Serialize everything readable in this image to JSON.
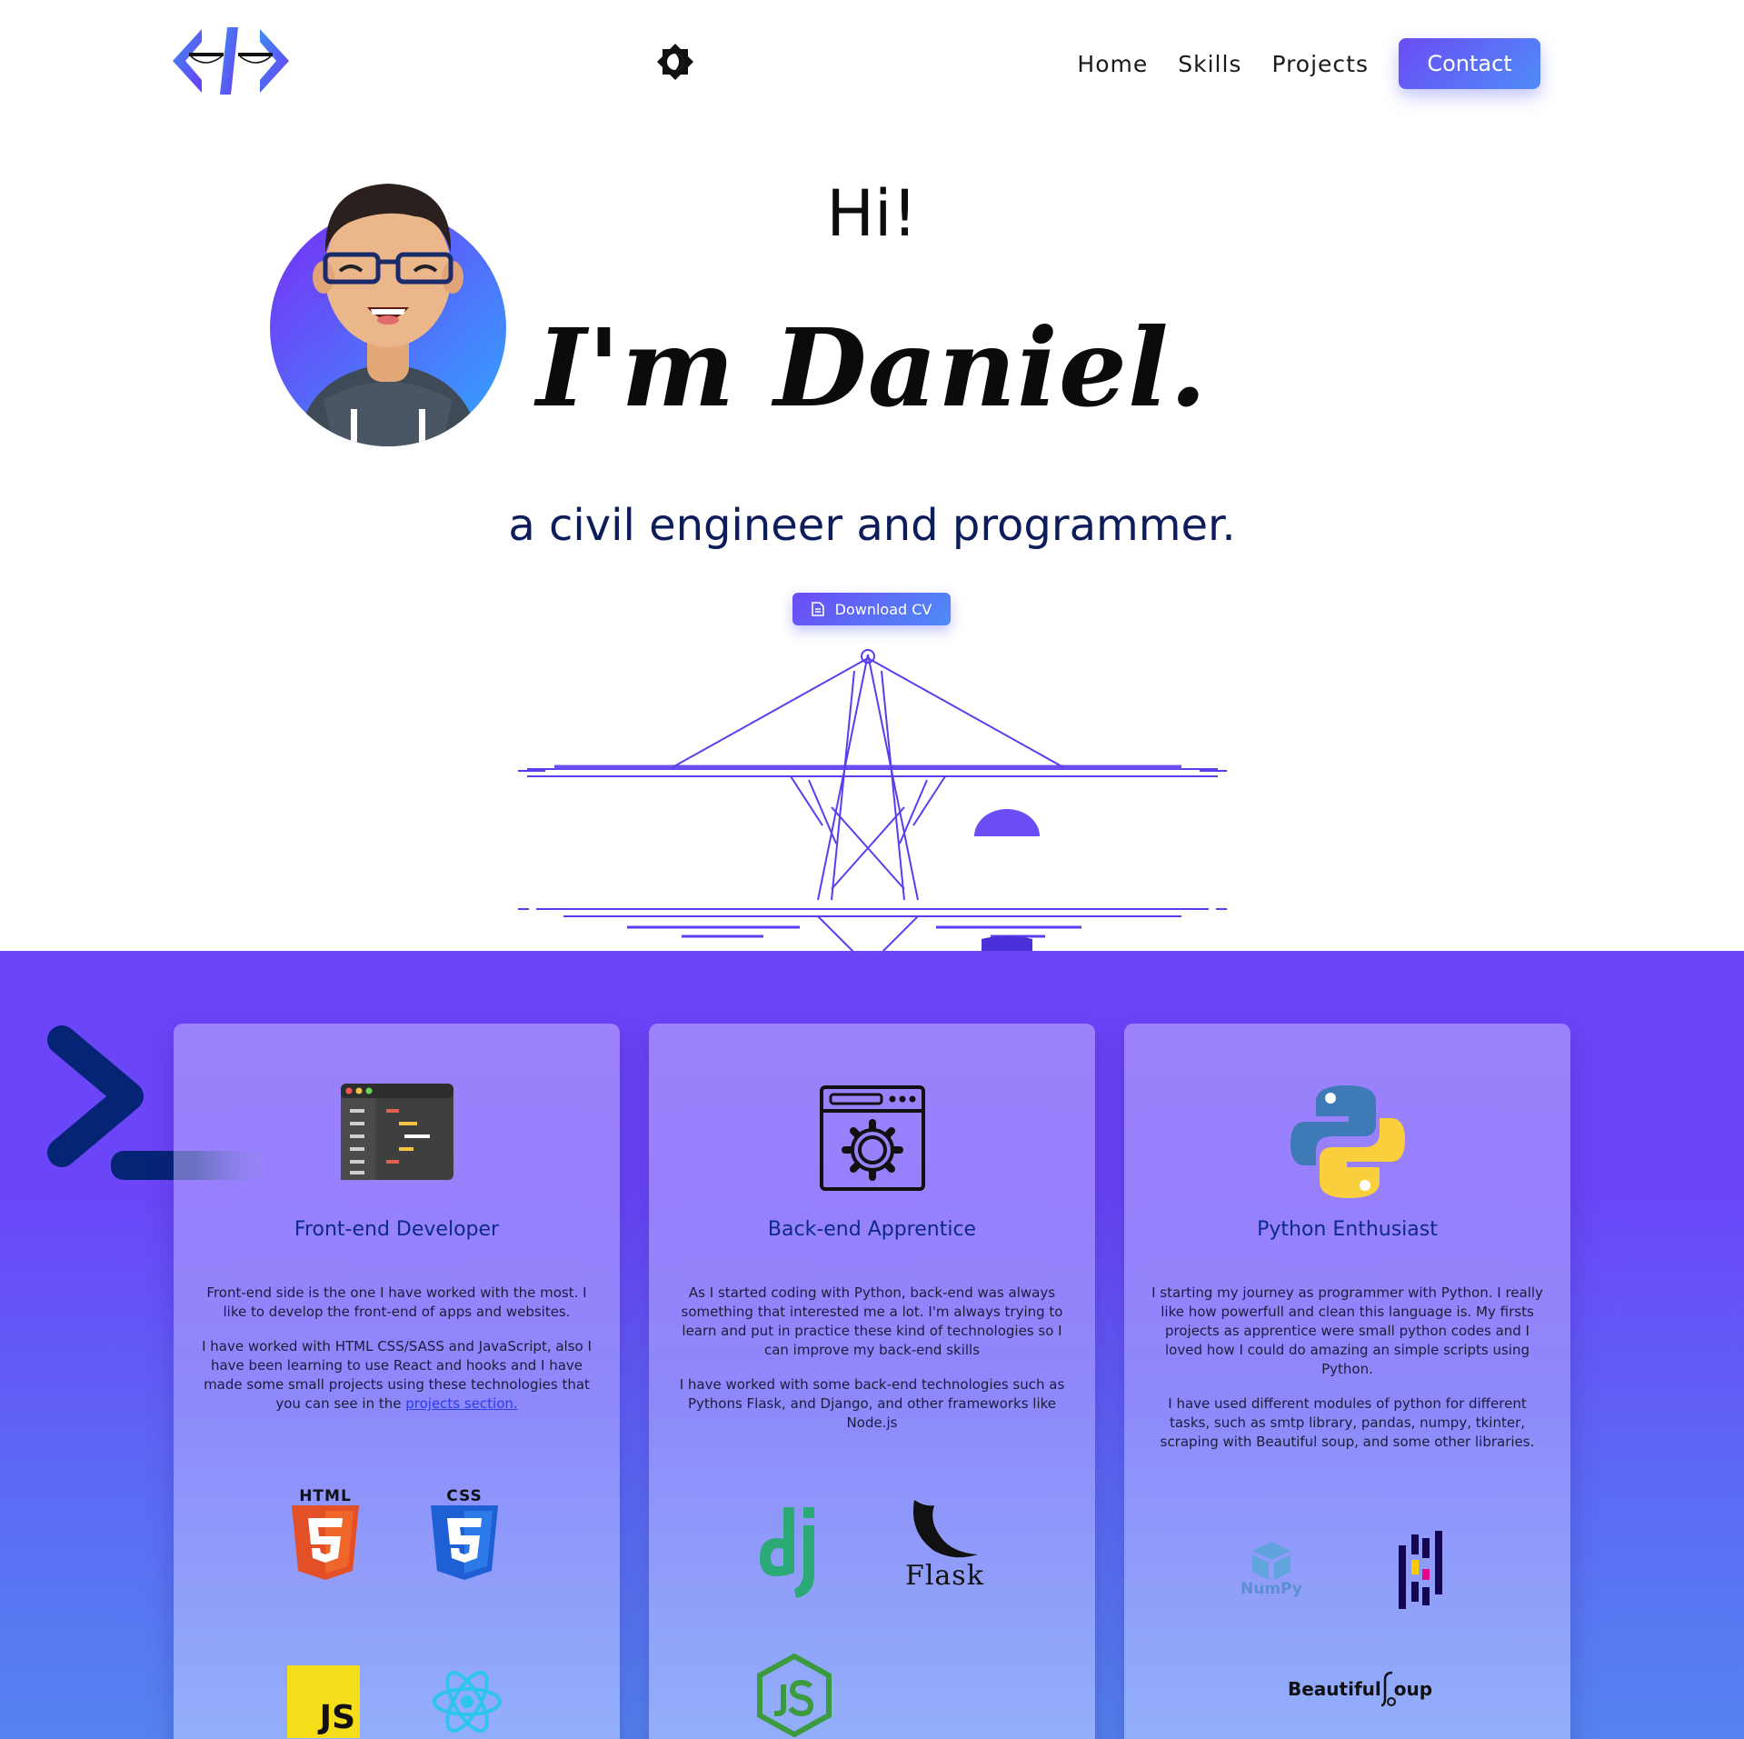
{
  "nav": {
    "home": "Home",
    "skills": "Skills",
    "projects": "Projects",
    "contact": "Contact"
  },
  "hero": {
    "greeting": "Hi!",
    "name": "I'm Daniel.",
    "role": "a civil engineer and programmer.",
    "cv_button": "Download CV"
  },
  "cards": [
    {
      "title": "Front-end Developer",
      "p1": "Front-end side is the one I have worked with the most. I like to develop the front-end of apps and websites.",
      "p2": "I have worked with HTML CSS/SASS and JavaScript, also I have been learning to use React and hooks and I have made some small projects using these technologies that you can see in the ",
      "link": "projects section.",
      "techs": [
        "HTML",
        "CSS",
        "JS",
        "React"
      ]
    },
    {
      "title": "Back-end Apprentice",
      "p1": "As I started coding with Python, back-end was always something that interested me a lot. I'm always trying to learn and put in practice these kind of technologies so I can improve my back-end skills",
      "p2": "I have worked with some back-end technologies such as Pythons Flask, and Django, and other frameworks like Node.js",
      "techs": [
        "dj",
        "Flask",
        "Node.js"
      ]
    },
    {
      "title": "Python Enthusiast",
      "p1": "I starting my journey as programmer with Python. I really like how powerfull and clean this language is. My firsts projects as apprentice were small python codes and I loved how I could do amazing an simple scripts using Python.",
      "p2": "I have used different modules of python for different tasks, such as smtp library, pandas, numpy, tkinter, scraping with Beautiful soup, and some other libraries.",
      "techs": [
        "NumPy",
        "pandas",
        "Beautiful Soup"
      ]
    }
  ],
  "tech_labels": {
    "html": "HTML",
    "css": "CSS",
    "js": "JS",
    "flask": "Flask",
    "numpy": "NumPy",
    "bs_left": "Beautiful",
    "bs_right": "oup"
  },
  "colors": {
    "accent": "#6b4cf5",
    "accent2": "#4f8cf7",
    "section_bg": "#6b45f8",
    "title_blue": "#0d2a8a",
    "role_navy": "#0d1c5a"
  },
  "icons": {
    "logo": "code-brackets-glasses-logo",
    "theme": "brightness-icon",
    "cv": "document-icon",
    "terminal": "terminal-prompt-icon"
  }
}
